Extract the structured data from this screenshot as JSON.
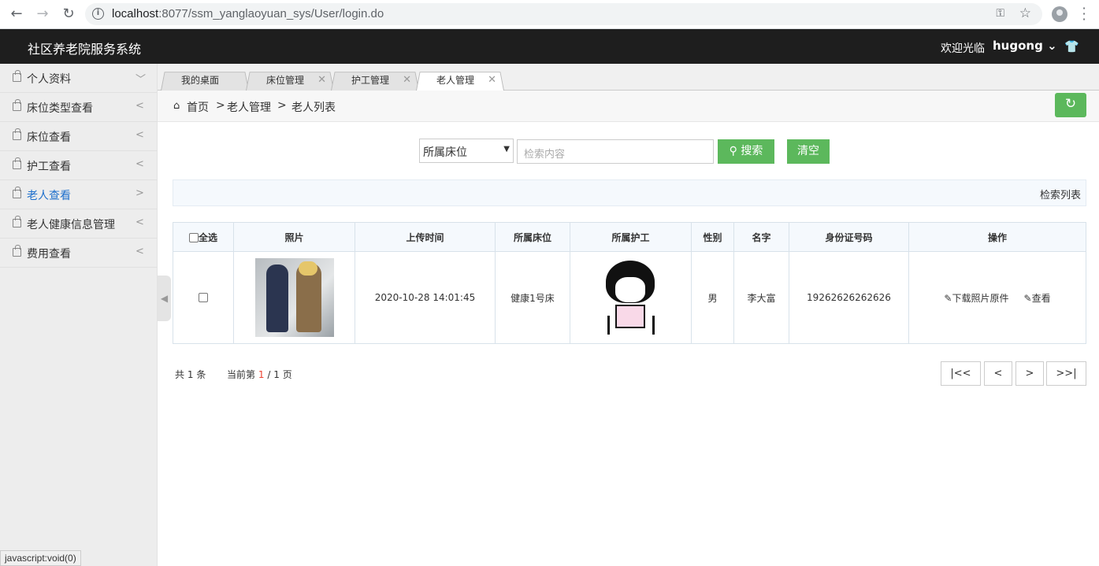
{
  "browser": {
    "url_host": "localhost",
    "url_path": ":8077/ssm_yanglaoyuan_sys/User/login.do",
    "status_text": "javascript:void(0)"
  },
  "topbar": {
    "brand": "社区养老院服务系统",
    "welcome": "欢迎光临",
    "user": "hugong"
  },
  "sidebar": {
    "items": [
      {
        "label": "个人资料",
        "arrow": "﹀"
      },
      {
        "label": "床位类型查看",
        "arrow": "<"
      },
      {
        "label": "床位查看",
        "arrow": "<"
      },
      {
        "label": "护工查看",
        "arrow": "<"
      },
      {
        "label": "老人查看",
        "arrow": ">"
      },
      {
        "label": "老人健康信息管理",
        "arrow": "<"
      },
      {
        "label": "费用查看",
        "arrow": "<"
      }
    ]
  },
  "tabs": [
    {
      "label": "我的桌面"
    },
    {
      "label": "床位管理"
    },
    {
      "label": "护工管理"
    },
    {
      "label": "老人管理"
    }
  ],
  "breadcrumb": {
    "home": "首页",
    "level1": "老人管理",
    "level2": "老人列表",
    "sep": ">"
  },
  "search": {
    "select_value": "所属床位",
    "placeholder": "检索内容",
    "search_label": "搜索",
    "clear_label": "清空"
  },
  "panel": {
    "title": "检索列表"
  },
  "table": {
    "headers": [
      "全选",
      "照片",
      "上传时间",
      "所属床位",
      "所属护工",
      "性别",
      "名字",
      "身份证号码",
      "操作"
    ],
    "rows": [
      {
        "time": "2020-10-28 14:01:45",
        "bed": "健康1号床",
        "gender": "男",
        "name": "李大富",
        "id_number": "19262626262626",
        "action_download": "下载照片原件",
        "action_view": "查看"
      }
    ]
  },
  "pagination": {
    "total_prefix": "共",
    "total": "1",
    "total_suffix": "条",
    "current_prefix": "当前第",
    "current": "1",
    "slash": "/",
    "pages": "1",
    "pages_suffix": "页",
    "first": "|<<",
    "prev": "<",
    "next": ">",
    "last": ">>|"
  }
}
